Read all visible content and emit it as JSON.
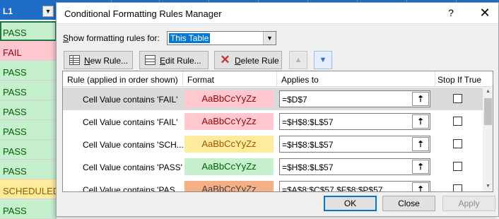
{
  "sheet": {
    "column_header": "L1",
    "filter_icon": "chevron-down-icon",
    "cells": [
      {
        "text": "PASS",
        "status": "pass"
      },
      {
        "text": "FAIL",
        "status": "fail"
      },
      {
        "text": "PASS",
        "status": "pass"
      },
      {
        "text": "PASS",
        "status": "pass"
      },
      {
        "text": "PASS",
        "status": "pass"
      },
      {
        "text": "PASS",
        "status": "pass"
      },
      {
        "text": "PASS",
        "status": "pass"
      },
      {
        "text": "PASS",
        "status": "pass"
      },
      {
        "text": "SCHEDULED-",
        "status": "sched"
      },
      {
        "text": "PASS",
        "status": "pass"
      }
    ]
  },
  "dialog": {
    "title": "Conditional Formatting Rules Manager",
    "help": "?",
    "close": "✕",
    "show_label_prefix": "S",
    "show_label_rest": "how formatting rules for:",
    "show_value": "This Table",
    "toolbar": {
      "new_prefix": "N",
      "new_rest": "ew Rule...",
      "edit_prefix": "E",
      "edit_rest": "dit Rule...",
      "delete_prefix": "D",
      "delete_rest": "elete Rule",
      "move_up": "▲",
      "move_down": "▼"
    },
    "columns": {
      "rule": "Rule (applied in order shown)",
      "format": "Format",
      "applies_to": "Applies to",
      "stop_if_true": "Stop If True"
    },
    "rules": [
      {
        "rule": "Cell Value contains 'FAIL'",
        "preview": "AaBbCcYyZz",
        "applies": "=$D$7",
        "stop": false,
        "fill": "#ffc7ce",
        "text_color": "#9c0006"
      },
      {
        "rule": "Cell Value contains 'FAIL'",
        "preview": "AaBbCcYyZz",
        "applies": "=$H$8:$L$57",
        "stop": false,
        "fill": "#ffc7ce",
        "text_color": "#9c0006"
      },
      {
        "rule": "Cell Value contains 'SCH...",
        "preview": "AaBbCcYyZz",
        "applies": "=$H$8:$L$57",
        "stop": false,
        "fill": "#ffeb9c",
        "text_color": "#9c5700"
      },
      {
        "rule": "Cell Value contains 'PASS'",
        "preview": "AaBbCcYyZz",
        "applies": "=$H$8:$L$57",
        "stop": false,
        "fill": "#c6efce",
        "text_color": "#006100"
      },
      {
        "rule": "Cell Value contains 'PAS...",
        "preview": "AaBbCcYyZz",
        "applies": "=$A$8:$C$57,$F$8:$P$57",
        "stop": false,
        "fill": "#f4b084",
        "text_color": "#3f3f3f"
      }
    ],
    "ref_icon": "⇡",
    "buttons": {
      "ok": "OK",
      "close": "Close",
      "apply": "Apply"
    }
  },
  "colors": {
    "header_blue": "#1e6ec8",
    "selection_blue": "#0078d7"
  }
}
